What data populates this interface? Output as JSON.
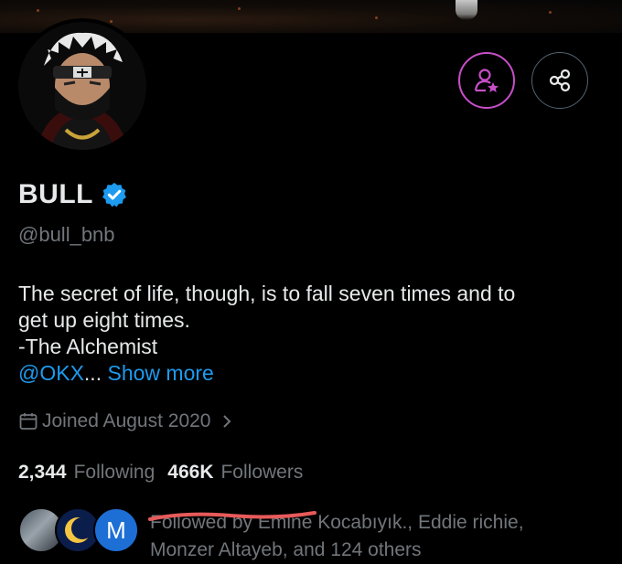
{
  "profile": {
    "name": "BULL",
    "handle": "@bull_bnb",
    "bio_lines": [
      "The secret of life, though, is to fall seven times and to",
      "get up eight times.",
      "-The Alchemist"
    ],
    "bio_link": "@OKX",
    "bio_ellipsis": "...",
    "show_more": "Show more",
    "joined": "Joined August 2020",
    "following_count": "2,344",
    "following_label": "Following",
    "followers_count": "466K",
    "followers_label": "Followers",
    "followed_by_line1": "Followed by Emine Kocabıyık., Eddie richie,",
    "followed_by_line2": "Monzer Altayeb, and 124 others",
    "follower_avatar_3_initial": "M"
  },
  "colors": {
    "accent_blue": "#1d9bf0",
    "subscribe_purple": "#c64fc8",
    "muted_text": "#71767b",
    "strike_red": "#e85a5a"
  },
  "icons": {
    "subscribe": "person-star-icon",
    "share": "share-icon",
    "verified": "verified-badge-icon",
    "calendar": "calendar-icon",
    "chevron": "chevron-right-icon"
  }
}
